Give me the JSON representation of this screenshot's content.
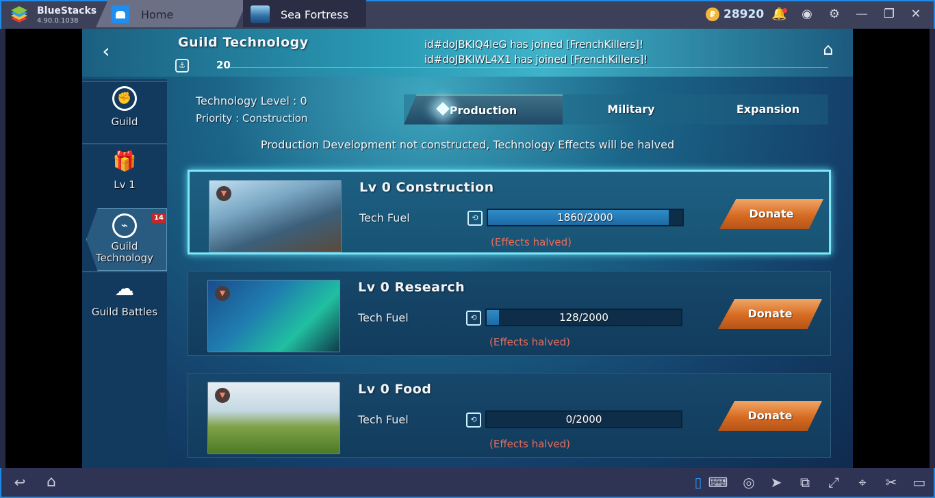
{
  "titlebar": {
    "app_name": "BlueStacks",
    "version": "4.90.0.1038",
    "tabs": [
      {
        "label": "Home",
        "icon": "home-app-icon"
      },
      {
        "label": "Sea Fortress",
        "icon": "sea-fortress-game-icon",
        "active": true
      }
    ],
    "coins": "28920",
    "coin_symbol": "₽",
    "icons": {
      "bell": "🔔",
      "profile": "◉",
      "settings": "⚙",
      "minimize": "—",
      "restore": "❐",
      "close": "✕"
    }
  },
  "header": {
    "back_icon": "‹",
    "title": "Guild Technology",
    "guild_icon": "⚓",
    "guild_count": "20",
    "notices": [
      "id#doJBKIQ4leG has joined [FrenchKillers]!",
      "id#doJBKIWL4X1 has joined [FrenchKillers]!"
    ],
    "home_icon": "⌂"
  },
  "sidebar": {
    "items": [
      {
        "label": "Guild",
        "icon": "✊"
      },
      {
        "label": "Lv 1",
        "icon": "🎁"
      },
      {
        "label_line1": "Guild",
        "label_line2": "Technology",
        "icon": "⌁",
        "badge": "14",
        "active": true
      },
      {
        "label": "Guild Battles",
        "icon": "☁"
      }
    ]
  },
  "info": {
    "tech_level": "Technology Level : 0",
    "priority": "Priority : Construction"
  },
  "tabs": [
    {
      "label": "Production",
      "active": true
    },
    {
      "label": "Military"
    },
    {
      "label": "Expansion"
    }
  ],
  "warning": "Production Development not constructed, Technology Effects will be halved",
  "cards": [
    {
      "title": "Lv  0 Construction",
      "fuel_label": "Tech Fuel",
      "progress": "1860/2000",
      "progress_fraction": 0.93,
      "status": "(Effects halved)",
      "button": "Donate",
      "badge_icon": "▼",
      "selected": true
    },
    {
      "title": "Lv  0 Research",
      "fuel_label": "Tech Fuel",
      "progress": "128/2000",
      "progress_fraction": 0.064,
      "status": "(Effects halved)",
      "button": "Donate",
      "badge_icon": "▼"
    },
    {
      "title": "Lv  0 Food",
      "fuel_label": "Tech Fuel",
      "progress": "0/2000",
      "progress_fraction": 0,
      "status": "(Effects halved)",
      "button": "Donate",
      "badge_icon": "▼"
    }
  ],
  "fuel_icon": "⟲",
  "navbar": {
    "left": [
      {
        "icon": "↩",
        "name": "back"
      },
      {
        "icon": "⌂",
        "name": "home"
      }
    ],
    "right": [
      {
        "icon": "▯",
        "name": "portrait-mode"
      },
      {
        "icon": "⌨",
        "name": "keyboard"
      },
      {
        "icon": "◎",
        "name": "eye"
      },
      {
        "icon": "➤",
        "name": "pointer"
      },
      {
        "icon": "⧉",
        "name": "rotate"
      },
      {
        "icon": "⤢",
        "name": "fullscreen"
      },
      {
        "icon": "⌖",
        "name": "location"
      },
      {
        "icon": "✂",
        "name": "scissors"
      },
      {
        "icon": "▭",
        "name": "shake"
      }
    ]
  }
}
